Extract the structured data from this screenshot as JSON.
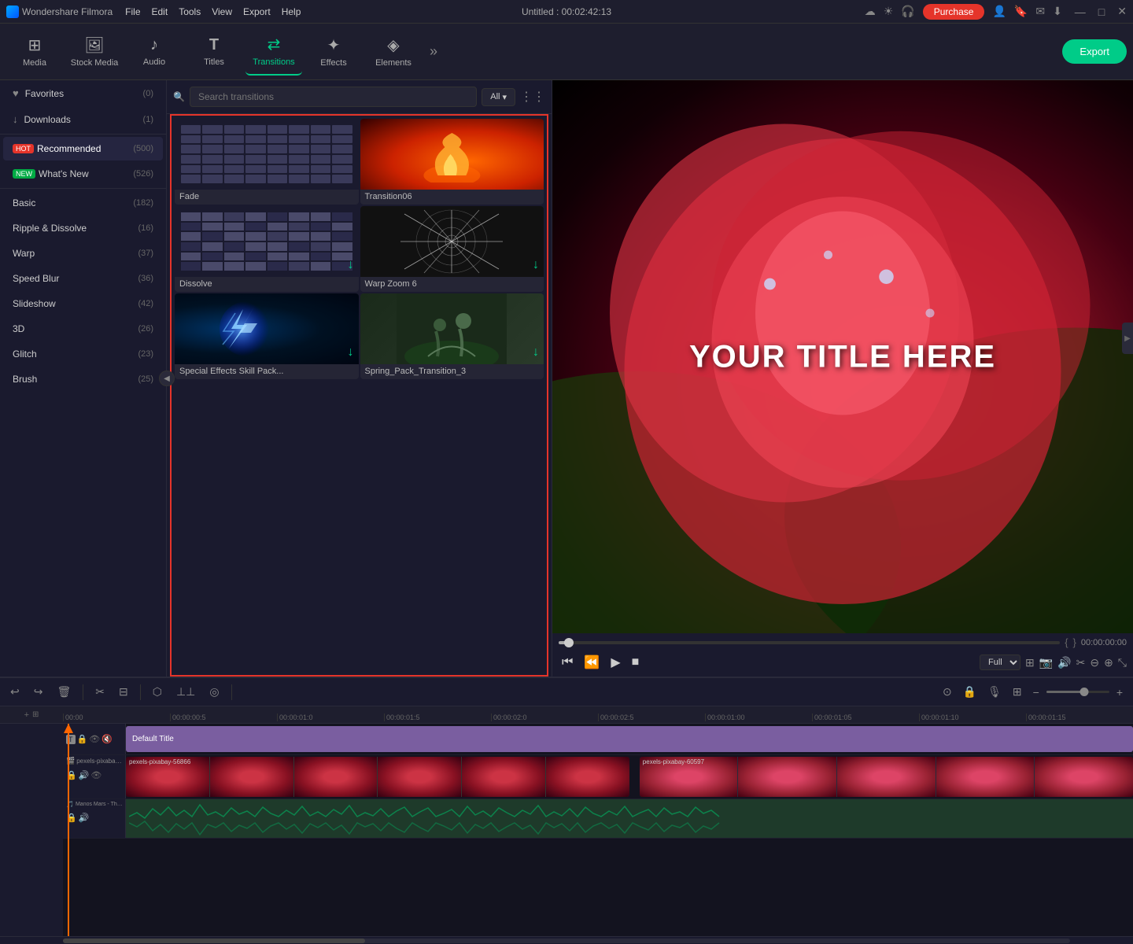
{
  "app": {
    "name": "Wondershare Filmora",
    "logo_icon": "W",
    "title": "Untitled : 00:02:42:13"
  },
  "titlebar": {
    "menu": [
      "File",
      "Edit",
      "Tools",
      "View",
      "Export",
      "Help"
    ],
    "purchase_label": "Purchase",
    "window_controls": [
      "—",
      "□",
      "✕"
    ]
  },
  "toolbar": {
    "items": [
      {
        "id": "media",
        "label": "Media",
        "icon": "☰"
      },
      {
        "id": "stock_media",
        "label": "Stock Media",
        "icon": "🖼"
      },
      {
        "id": "audio",
        "label": "Audio",
        "icon": "♪"
      },
      {
        "id": "titles",
        "label": "Titles",
        "icon": "T"
      },
      {
        "id": "transitions",
        "label": "Transitions",
        "icon": "⇄",
        "active": true
      },
      {
        "id": "effects",
        "label": "Effects",
        "icon": "✦"
      },
      {
        "id": "elements",
        "label": "Elements",
        "icon": "◈"
      }
    ],
    "more_icon": "»",
    "export_label": "Export"
  },
  "sidebar": {
    "items": [
      {
        "id": "favorites",
        "icon": "♥",
        "label": "Favorites",
        "count": "(0)"
      },
      {
        "id": "downloads",
        "icon": "↓",
        "label": "Downloads",
        "count": "(1)"
      },
      {
        "id": "recommended",
        "icon": "HOT",
        "label": "Recommended",
        "count": "(500)",
        "badge": "hot"
      },
      {
        "id": "whats_new",
        "icon": "NEW",
        "label": "What's New",
        "count": "(526)",
        "badge": "new"
      },
      {
        "id": "basic",
        "label": "Basic",
        "count": "(182)"
      },
      {
        "id": "ripple",
        "label": "Ripple & Dissolve",
        "count": "(16)"
      },
      {
        "id": "warp",
        "label": "Warp",
        "count": "(37)"
      },
      {
        "id": "speed_blur",
        "label": "Speed Blur",
        "count": "(36)"
      },
      {
        "id": "slideshow",
        "label": "Slideshow",
        "count": "(42)"
      },
      {
        "id": "3d",
        "label": "3D",
        "count": "(26)"
      },
      {
        "id": "glitch",
        "label": "Glitch",
        "count": "(23)"
      },
      {
        "id": "brush",
        "label": "Brush",
        "count": "(25)"
      }
    ]
  },
  "search": {
    "placeholder": "Search transitions",
    "filter_label": "All",
    "filter_icon": "▾"
  },
  "transitions": {
    "items": [
      {
        "id": "fade",
        "label": "Fade",
        "type": "fade"
      },
      {
        "id": "transition06",
        "label": "Transition06",
        "type": "fire"
      },
      {
        "id": "dissolve",
        "label": "Dissolve",
        "type": "dissolve"
      },
      {
        "id": "warp_zoom_6",
        "label": "Warp Zoom 6",
        "type": "warp"
      },
      {
        "id": "special_effects",
        "label": "Special Effects Skill Pack...",
        "type": "special",
        "has_download": true
      },
      {
        "id": "spring_pack",
        "label": "Spring_Pack_Transition_3",
        "type": "spring",
        "has_download": true
      }
    ]
  },
  "preview": {
    "title_text": "YOUR TITLE HERE",
    "timecode_current": "00:00:00:00",
    "timecode_start": "{",
    "timecode_end": "}",
    "quality": "Full",
    "progress_percent": 2
  },
  "timeline": {
    "ruler_marks": [
      "00:00",
      "00:00:00:5",
      "00:00:01:0",
      "00:00:01:5",
      "00:00:02:0",
      "00:00:02:5",
      "00:00:01:00",
      "00:00:01:05",
      "00:00:01:10",
      "00:00:01:15"
    ],
    "tracks": [
      {
        "type": "title",
        "label": "Default Title",
        "icon": "T"
      },
      {
        "type": "video",
        "label": "pexels-pixabay-56866",
        "icon": "▶"
      },
      {
        "type": "video2",
        "label": "pexels-pixabay-60597",
        "icon": "▶"
      },
      {
        "type": "audio",
        "label": "Manos Mars - The Tunning",
        "icon": "♪"
      }
    ]
  },
  "icons": {
    "search": "🔍",
    "heart": "♥",
    "download": "↓",
    "grid": "⋮⋮",
    "play": "▶",
    "pause": "⏸",
    "stop": "■",
    "rewind": "⏮",
    "ff": "⏭",
    "expand": "⤡",
    "camera": "📷",
    "volume": "🔊",
    "scissors": "✂",
    "undo": "↩",
    "redo": "↪",
    "delete": "🗑",
    "crop": "⊡",
    "zoom_in": "+",
    "zoom_out": "−"
  }
}
